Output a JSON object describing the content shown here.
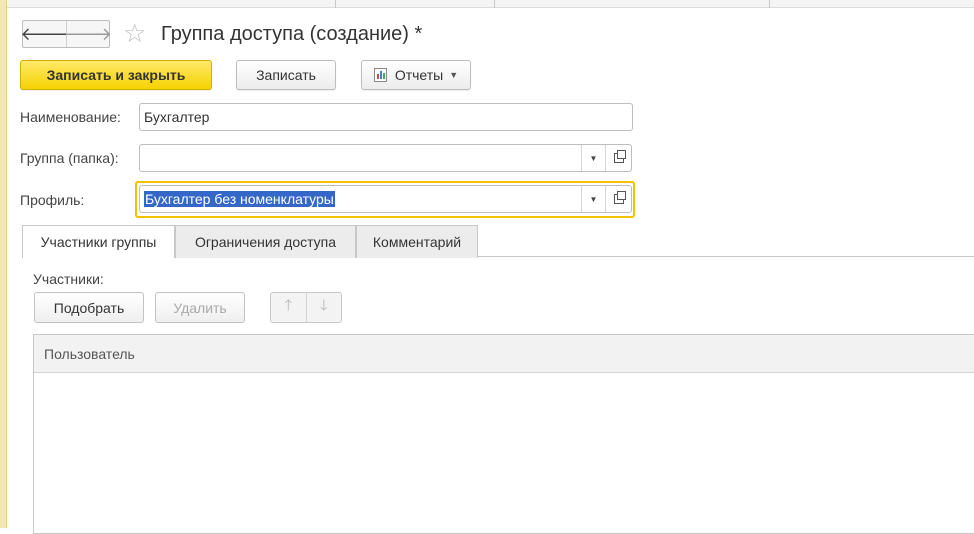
{
  "window": {
    "title": "Группа доступа (создание) *"
  },
  "nav": {
    "back_icon": "arrow-left-icon",
    "forward_icon": "arrow-right-icon",
    "favorite_icon": "star-icon"
  },
  "toolbar": {
    "save_close_label": "Записать и закрыть",
    "save_label": "Записать",
    "reports_label": "Отчеты"
  },
  "form": {
    "name": {
      "label": "Наименование:",
      "value": "Бухгалтер"
    },
    "group": {
      "label": "Группа (папка):",
      "value": ""
    },
    "profile": {
      "label": "Профиль:",
      "value": "Бухгалтер без номенклатуры"
    }
  },
  "tabs": [
    {
      "label": "Участники группы",
      "active": true
    },
    {
      "label": "Ограничения доступа",
      "active": false
    },
    {
      "label": "Комментарий",
      "active": false
    }
  ],
  "members": {
    "label": "Участники:",
    "pick_label": "Подобрать",
    "delete_label": "Удалить",
    "table_header": "Пользователь"
  },
  "colors": {
    "primary_button": "#f5d200",
    "focus_border": "#f2c200",
    "selection": "#3467c8"
  }
}
